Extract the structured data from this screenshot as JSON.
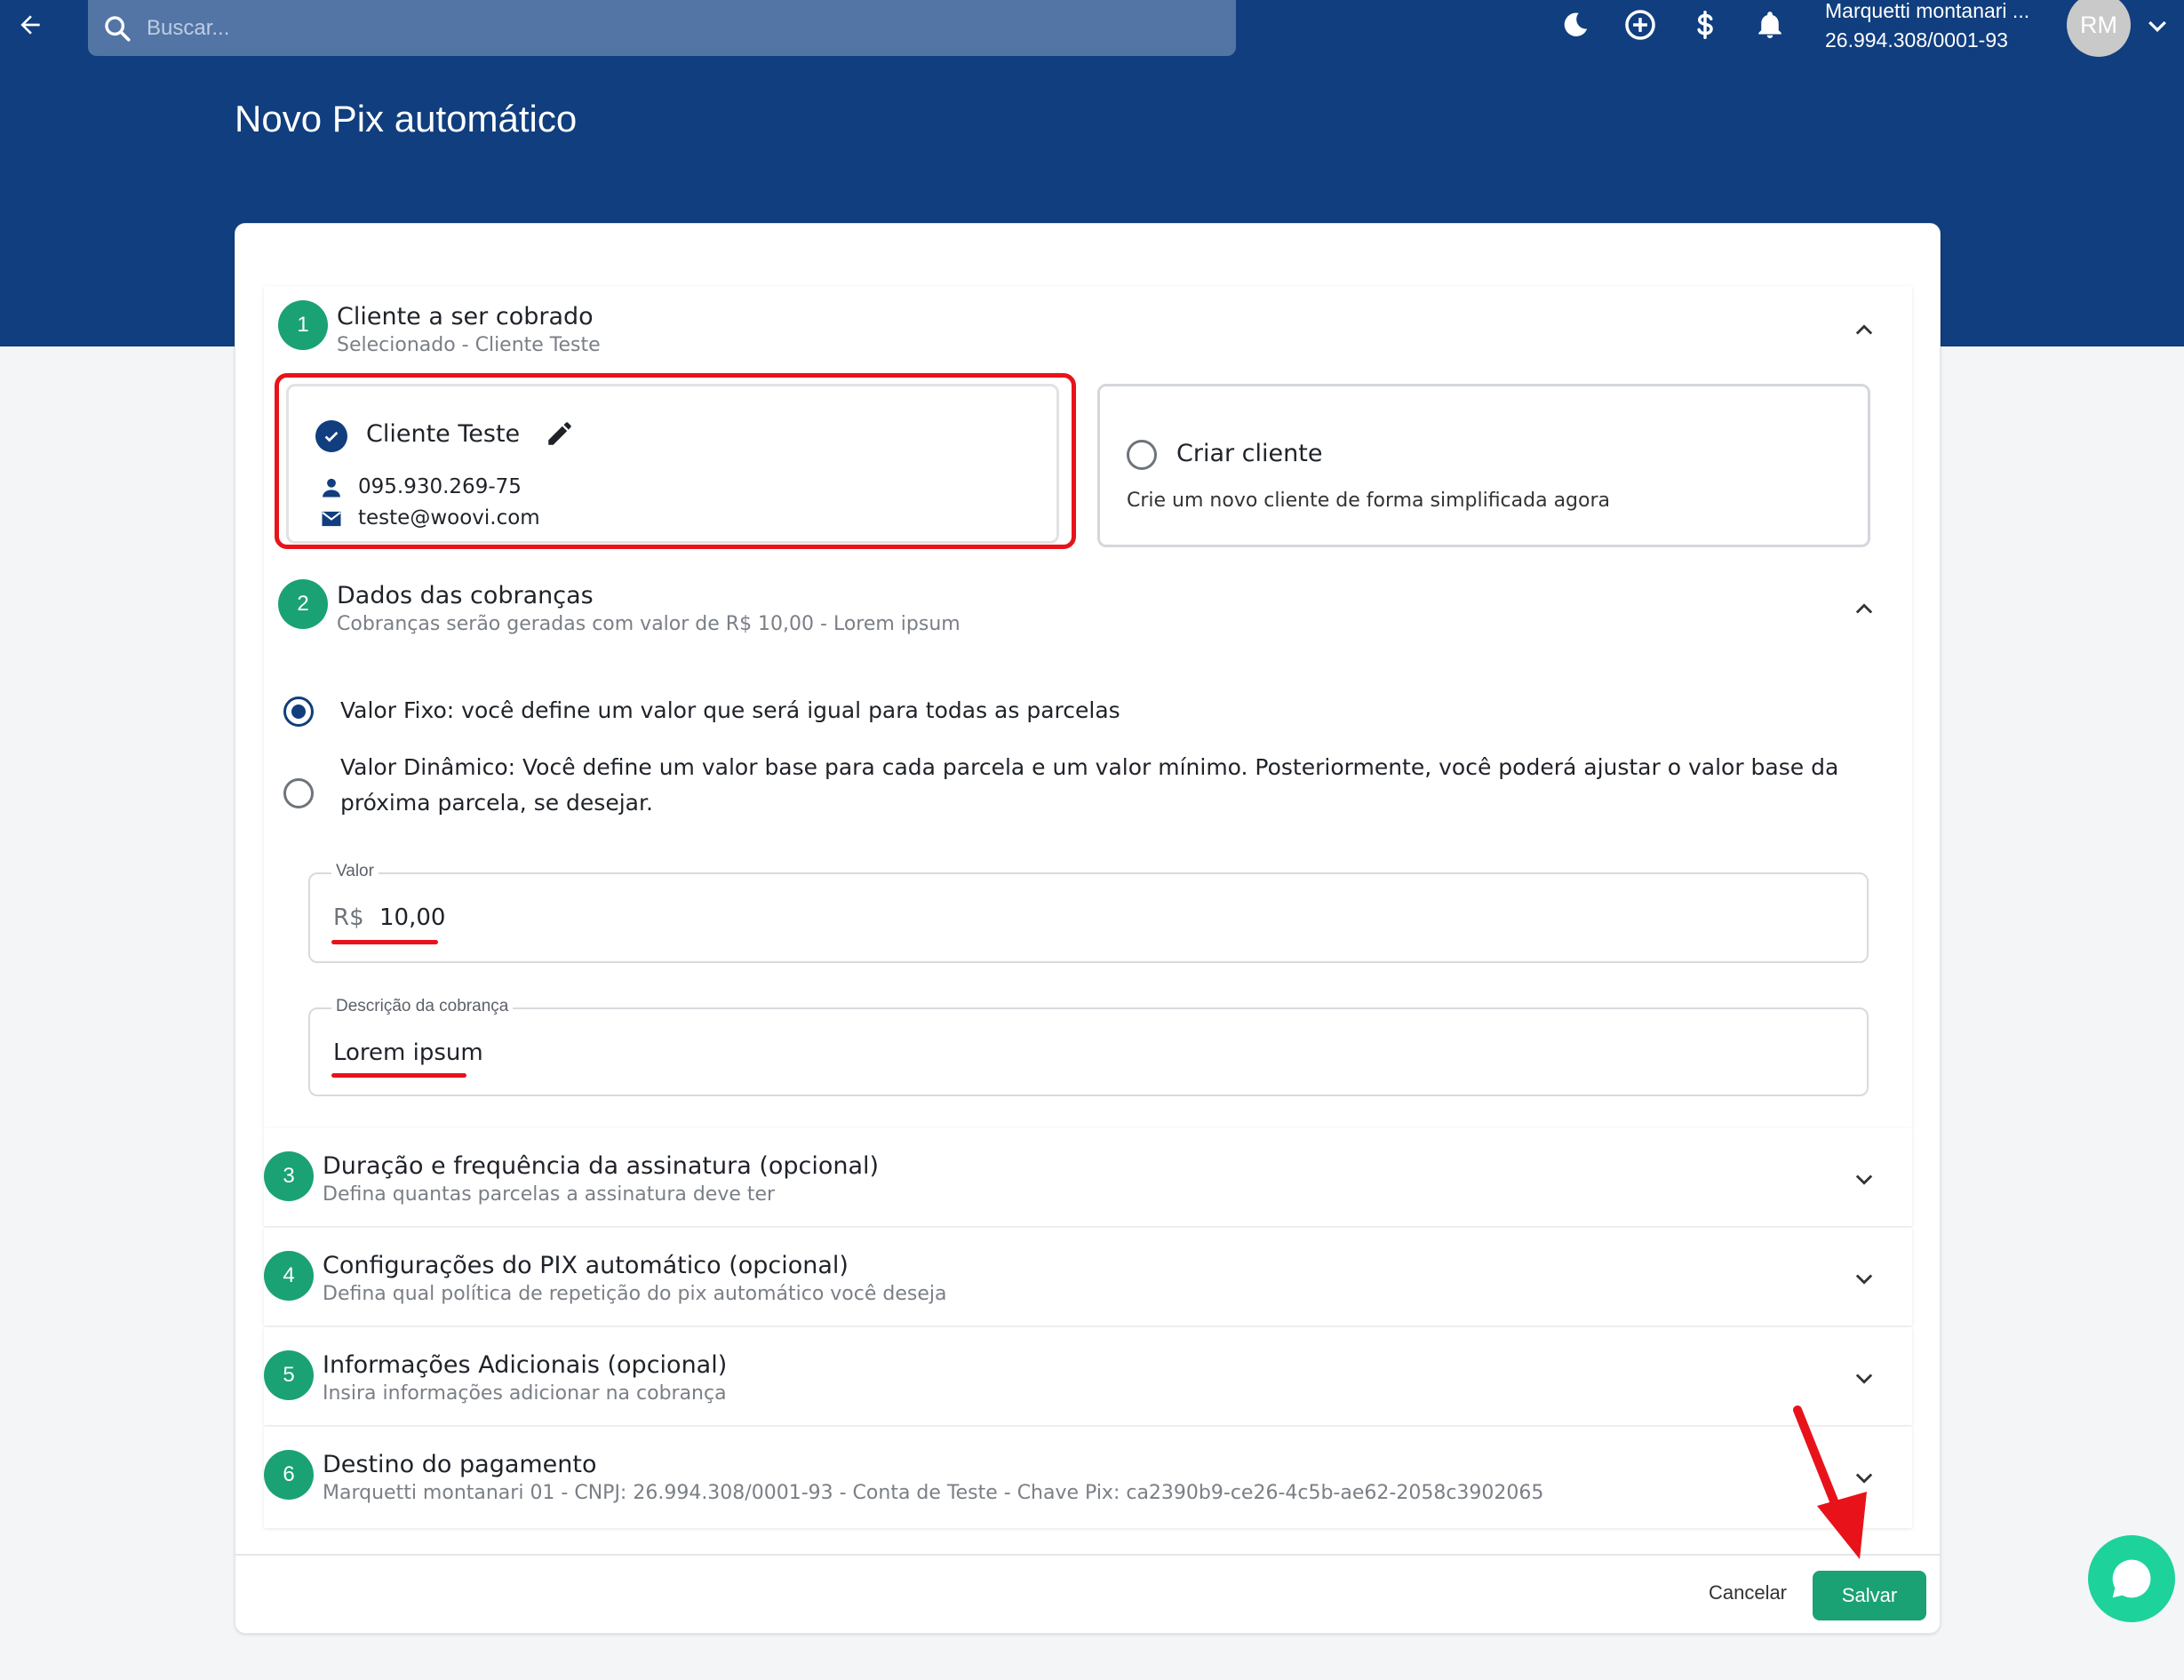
{
  "header": {
    "search_placeholder": "Buscar...",
    "account_name": "Marquetti montanari ...",
    "account_doc": "26.994.308/0001-93",
    "avatar_initials": "RM"
  },
  "page": {
    "title": "Novo Pix automático"
  },
  "sections": [
    {
      "num": "1",
      "title": "Cliente a ser cobrado",
      "subtitle": "Selecionado - Cliente Teste"
    },
    {
      "num": "2",
      "title": "Dados das cobranças",
      "subtitle": "Cobranças serão geradas com valor de R$ 10,00 - Lorem ipsum"
    },
    {
      "num": "3",
      "title": "Duração e frequência da assinatura (opcional)",
      "subtitle": "Defina quantas parcelas a assinatura deve ter"
    },
    {
      "num": "4",
      "title": "Configurações do PIX automático (opcional)",
      "subtitle": "Defina qual política de repetição do pix automático você deseja"
    },
    {
      "num": "5",
      "title": "Informações Adicionais (opcional)",
      "subtitle": "Insira informações adicionar na cobrança"
    },
    {
      "num": "6",
      "title": "Destino do pagamento",
      "subtitle": "Marquetti montanari 01 - CNPJ: 26.994.308/0001-93 - Conta de Teste - Chave Pix: ca2390b9-ce26-4c5b-ae62-2058c3902065"
    }
  ],
  "client": {
    "selected_name": "Cliente Teste",
    "tax_id": "095.930.269-75",
    "email": "teste@woovi.com",
    "create_title": "Criar cliente",
    "create_desc": "Crie um novo cliente de forma simplificada agora"
  },
  "charge": {
    "option_fixed": "Valor Fixo: você define um valor que será igual para todas as parcelas",
    "option_dynamic_line1": "Valor Dinâmico: Você define um valor base para cada parcela e um valor mínimo. Posteriormente, você poderá ajustar o valor base da",
    "option_dynamic_line2": "próxima parcela, se desejar.",
    "value_label": "Valor",
    "currency_prefix": "R$",
    "value": "10,00",
    "desc_label": "Descrição da cobrança",
    "desc_value": "Lorem ipsum"
  },
  "footer": {
    "cancel_label": "Cancelar",
    "save_label": "Salvar"
  },
  "colors": {
    "header_bg": "#103e7e",
    "accent_green": "#1aa274",
    "highlight_red": "#e8131a"
  }
}
